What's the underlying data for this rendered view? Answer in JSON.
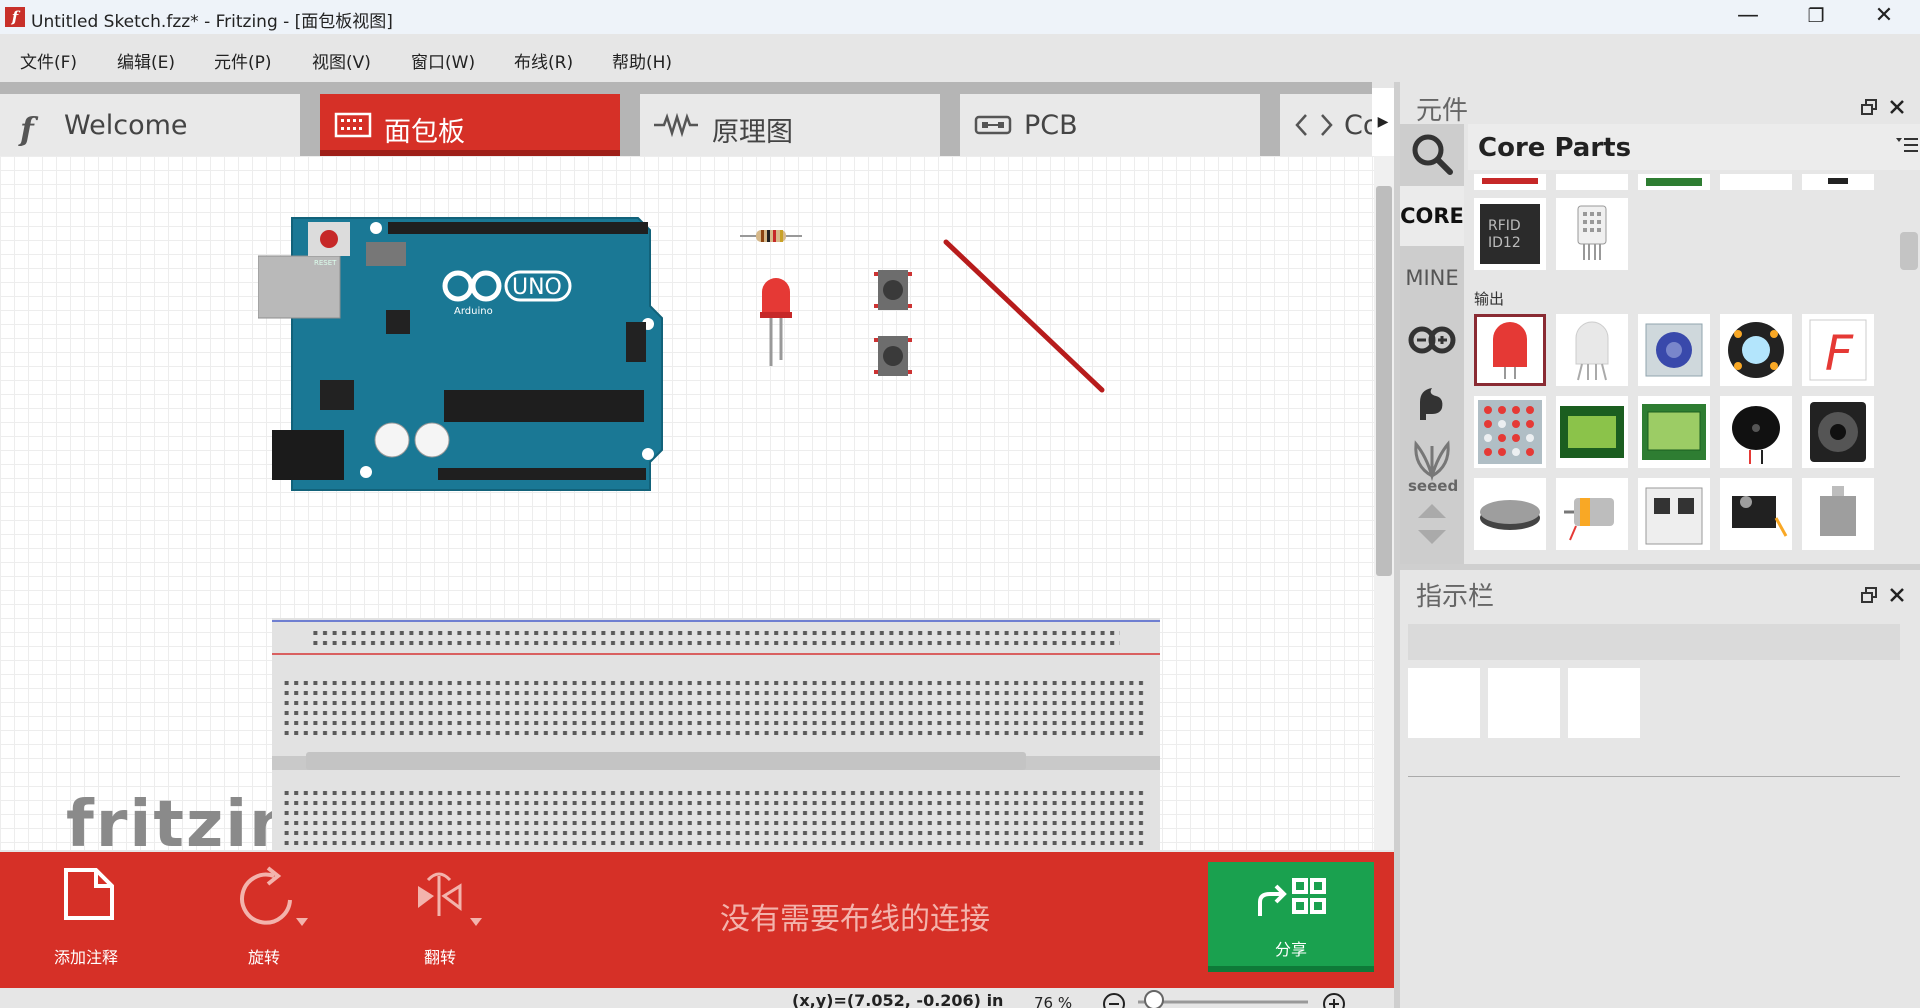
{
  "window": {
    "title": "Untitled Sketch.fzz* - Fritzing - [面包板视图]",
    "app_icon_glyph": "f",
    "controls": [
      "—",
      "❐",
      "✕"
    ]
  },
  "menu": [
    "文件(F)",
    "编辑(E)",
    "元件(P)",
    "视图(V)",
    "窗口(W)",
    "布线(R)",
    "帮助(H)"
  ],
  "tabs": [
    {
      "label": "Welcome",
      "icon": "fritzing-logo-icon"
    },
    {
      "label": "面包板",
      "icon": "breadboard-icon",
      "active": true
    },
    {
      "label": "原理图",
      "icon": "resistor-symbol-icon"
    },
    {
      "label": "PCB",
      "icon": "pcb-icon"
    },
    {
      "label": "Co",
      "icon": "code-icon"
    }
  ],
  "tab_scroll_glyph": "▶",
  "canvas": {
    "watermark": "fritzin",
    "arduino_labels": {
      "reset": "RESET",
      "uno": "UNO",
      "brand": "Arduino"
    }
  },
  "toolbar": {
    "add_note": "添加注释",
    "rotate": "旋转",
    "flip": "翻转",
    "routing_status": "没有需要布线的连接",
    "share": "分享"
  },
  "status": {
    "coords": "(x,y)=(7.052, -0.206) in",
    "zoom": "76 %"
  },
  "parts_panel": {
    "title": "元件",
    "bin_title": "Core Parts",
    "bins": [
      "CORE",
      "MINE"
    ],
    "seeed_label": "seeed",
    "category_output": "输出",
    "rfid_label_1": "RFID",
    "rfid_label_2": "ID12",
    "seven_seg_glyph": "F"
  },
  "inspector": {
    "title": "指示栏"
  },
  "colors": {
    "accent_red": "#d63027",
    "share_green": "#1aa14f"
  }
}
